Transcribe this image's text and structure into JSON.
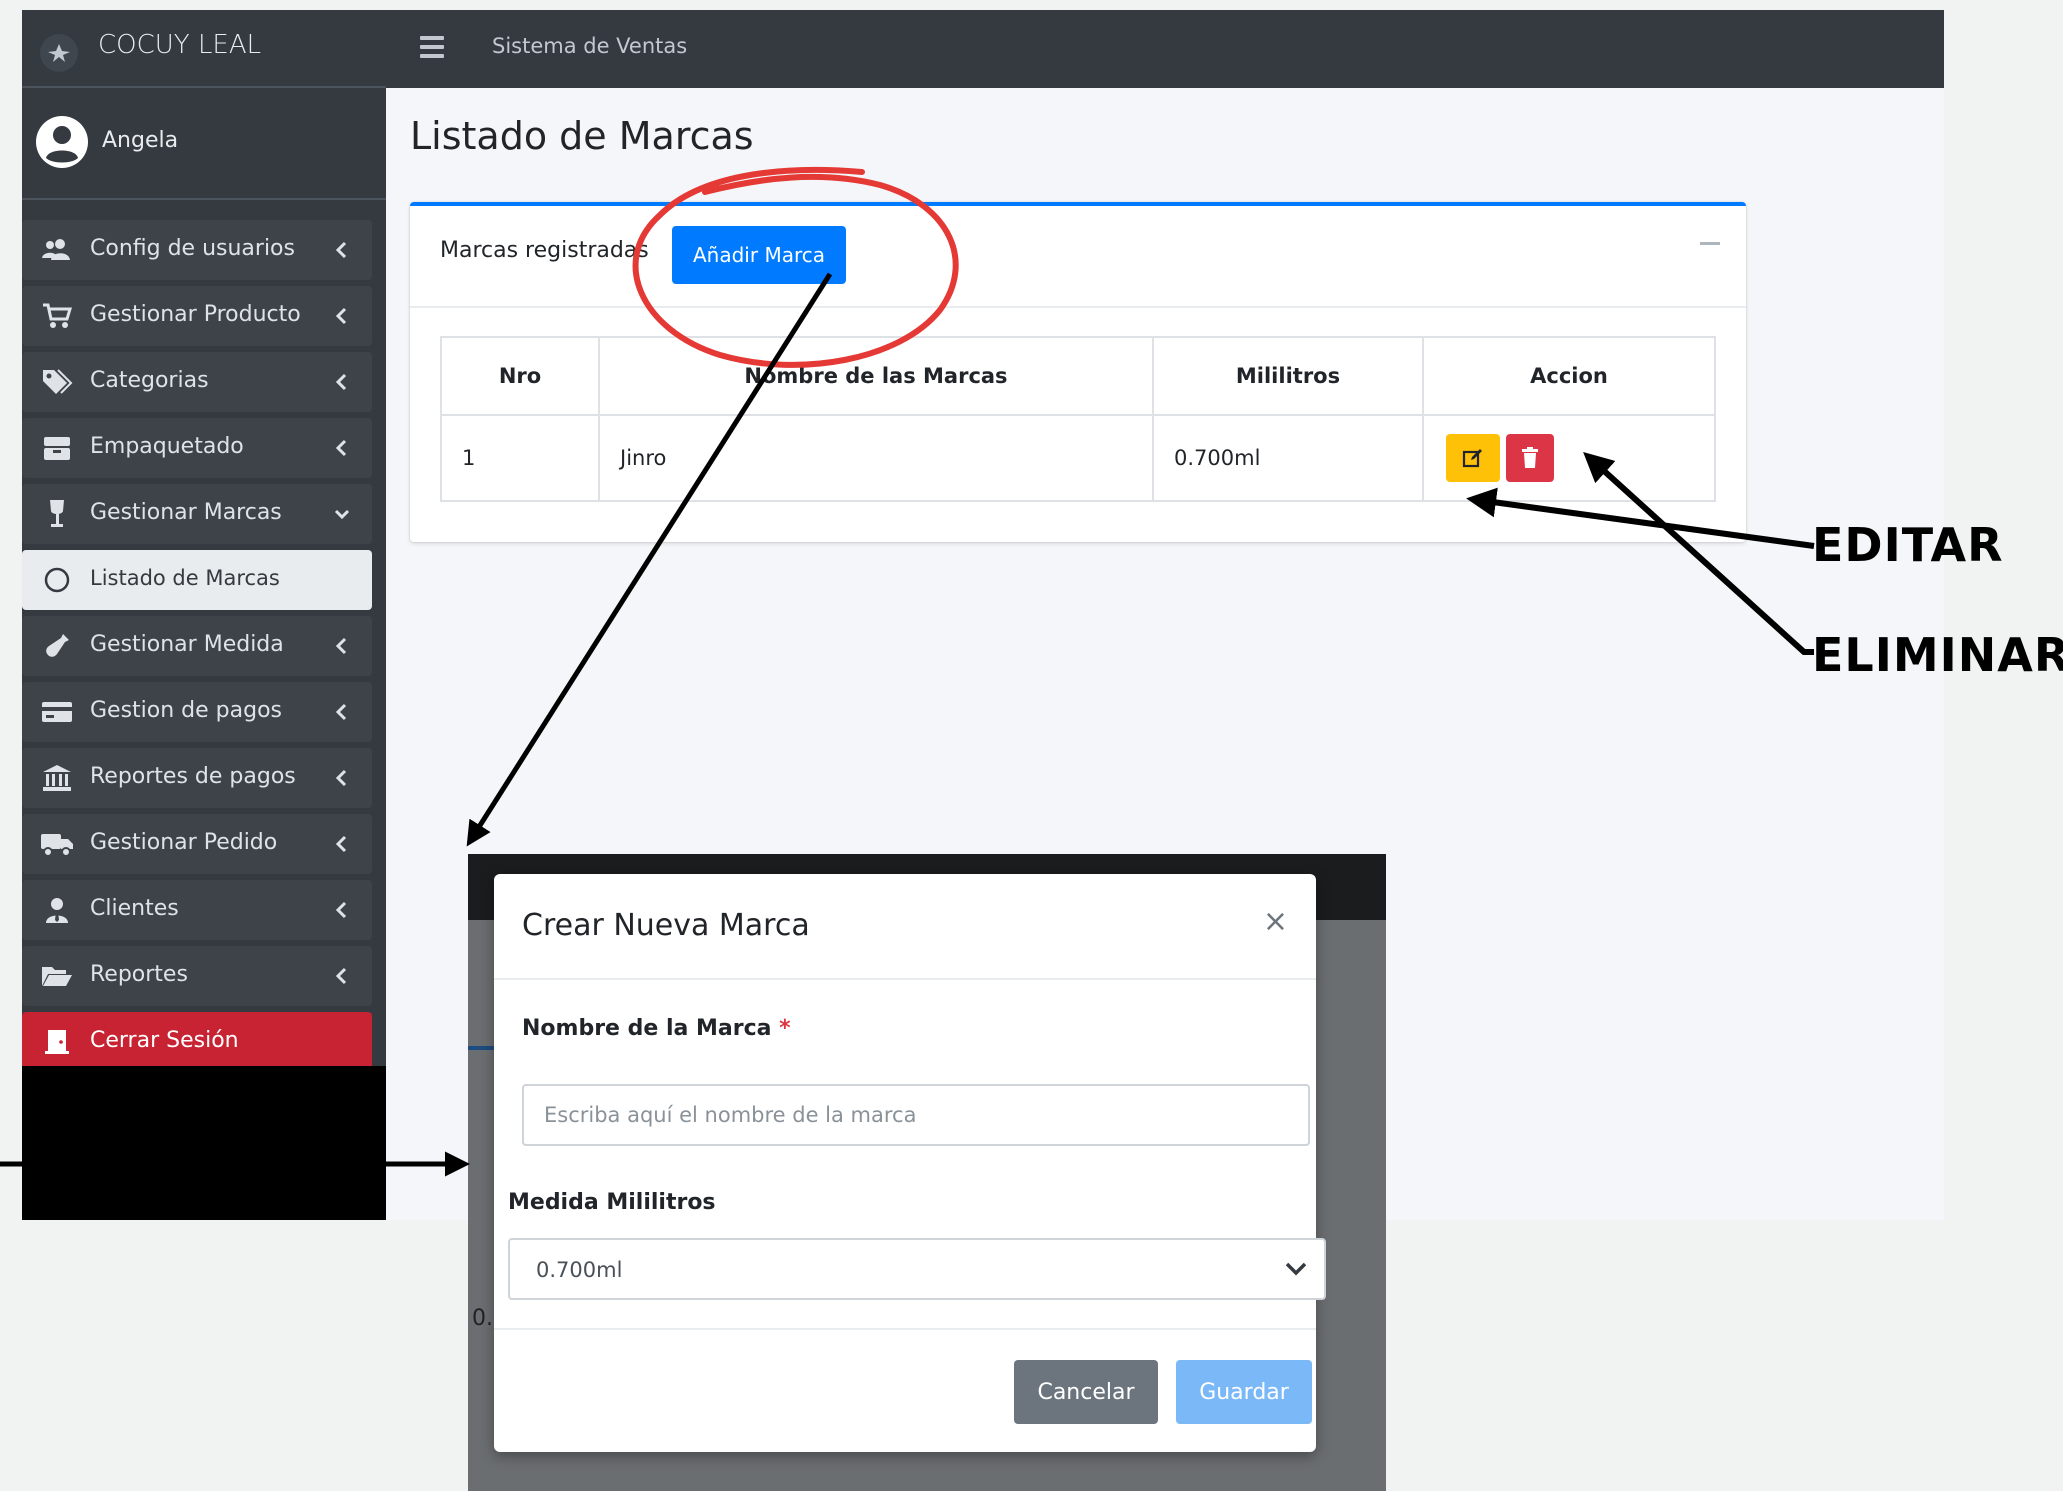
{
  "brand": {
    "name": "COCUY LEAL"
  },
  "user": {
    "name": "Angela"
  },
  "topbar": {
    "title": "Sistema de Ventas"
  },
  "sidebar": {
    "items": [
      {
        "label": "Config de usuarios",
        "icon": "users-cog-icon"
      },
      {
        "label": "Gestionar Producto",
        "icon": "cart-icon"
      },
      {
        "label": "Categorias",
        "icon": "tags-icon"
      },
      {
        "label": "Empaquetado",
        "icon": "box-icon"
      },
      {
        "label": "Gestionar Marcas",
        "icon": "wine-glass-icon"
      },
      {
        "label": "Listado de Marcas",
        "icon": "circle-icon"
      },
      {
        "label": "Gestionar Medida",
        "icon": "wine-bottle-icon"
      },
      {
        "label": "Gestion de pagos",
        "icon": "credit-card-icon"
      },
      {
        "label": "Reportes de pagos",
        "icon": "bank-icon"
      },
      {
        "label": "Gestionar Pedido",
        "icon": "truck-icon"
      },
      {
        "label": "Clientes",
        "icon": "user-tie-icon"
      },
      {
        "label": "Reportes",
        "icon": "folder-open-icon"
      },
      {
        "label": "Cerrar Sesión",
        "icon": "door-icon"
      }
    ]
  },
  "page": {
    "title": "Listado de Marcas"
  },
  "card": {
    "title": "Marcas registradas",
    "add_button": "Añadir Marca",
    "table": {
      "headers": [
        "Nro",
        "Nombre de las Marcas",
        "Mililitros",
        "Accion"
      ],
      "rows": [
        {
          "nro": "1",
          "nombre": "Jinro",
          "mililitros": "0.700ml"
        }
      ]
    }
  },
  "annotations": {
    "edit": "EDITAR",
    "delete": "ELIMINAR"
  },
  "modal": {
    "title": "Crear Nueva Marca",
    "close": "×",
    "name_label": "Nombre de la Marca",
    "required_mark": "*",
    "name_placeholder": "Escriba aquí el nombre de la marca",
    "measure_label": "Medida Mililitros",
    "measure_selected": "0.700ml",
    "cancel": "Cancelar",
    "save": "Guardar",
    "background_fragment": "0."
  },
  "colors": {
    "primary": "#007bff",
    "warning": "#ffc107",
    "danger": "#dc3545",
    "sidebar": "#343a40",
    "annotation_circle": "#e53935"
  }
}
